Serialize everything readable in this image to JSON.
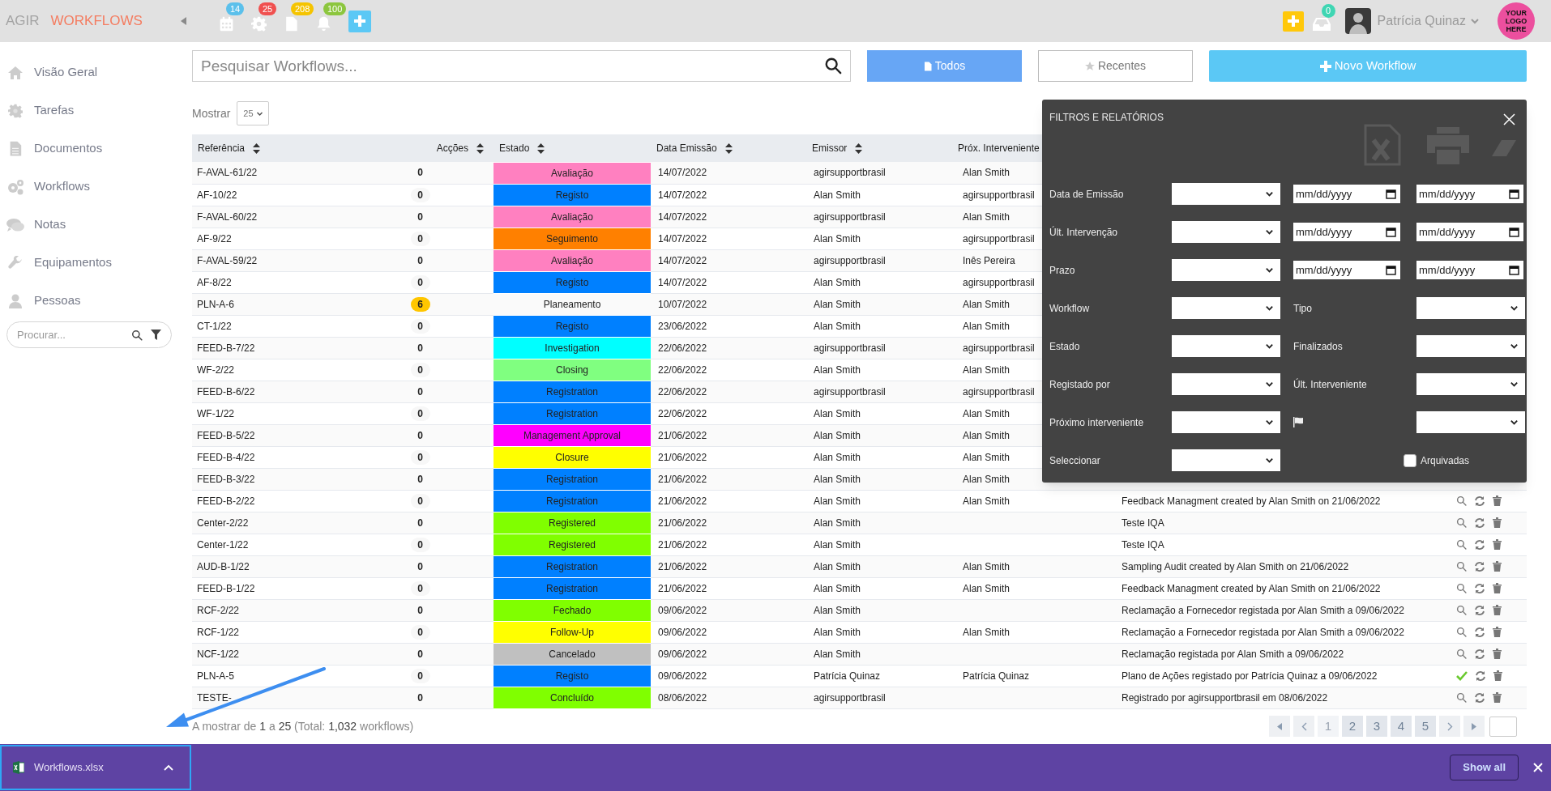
{
  "topbar": {
    "brand": "AGIR",
    "product": "WORKFLOWS",
    "notifications": [
      {
        "count": "14",
        "color": "#5bc0eb"
      },
      {
        "count": "25",
        "color": "#f0504f"
      },
      {
        "count": "208",
        "color": "#f5c400"
      },
      {
        "count": "100",
        "color": "#8cc63e"
      }
    ],
    "inbox_count": "0",
    "user": "Patrícia Quinaz",
    "logo_lines": [
      "YOUR",
      "LOGO",
      "HERE"
    ]
  },
  "sidebar": {
    "items": [
      {
        "label": "Visão Geral"
      },
      {
        "label": "Tarefas"
      },
      {
        "label": "Documentos"
      },
      {
        "label": "Workflows"
      },
      {
        "label": "Notas"
      },
      {
        "label": "Equipamentos"
      },
      {
        "label": "Pessoas"
      }
    ],
    "search": {
      "placeholder": "Procurar..."
    }
  },
  "search": {
    "placeholder": "Pesquisar Workflows..."
  },
  "view_tabs": [
    {
      "label": "Todos",
      "selected": true
    },
    {
      "label": "Recentes",
      "selected": false
    }
  ],
  "new_button": "Novo Workflow",
  "page_size": {
    "label": "Mostrar",
    "value": "25"
  },
  "table": {
    "columns": [
      "Referência",
      "Acções",
      "Estado",
      "Data Emissão",
      "Emissor",
      "Próx. Interveniente"
    ],
    "rows": [
      {
        "ref": "F-AVAL-61/22",
        "actions": "0",
        "flagged": false,
        "state": "Avaliação",
        "color": "#ff80c0",
        "date": "14/07/2022",
        "issuer": "agirsupportbrasil",
        "next": "Alan Smith"
      },
      {
        "ref": "AF-10/22",
        "actions": "0",
        "flagged": false,
        "state": "Registo",
        "color": "#0080ff",
        "date": "14/07/2022",
        "issuer": "Alan Smith",
        "next": "agirsupportbrasil"
      },
      {
        "ref": "F-AVAL-60/22",
        "actions": "0",
        "flagged": false,
        "state": "Avaliação",
        "color": "#ff80c0",
        "date": "14/07/2022",
        "issuer": "agirsupportbrasil",
        "next": "Alan Smith"
      },
      {
        "ref": "AF-9/22",
        "actions": "0",
        "flagged": false,
        "state": "Seguimento",
        "color": "#ff8000",
        "date": "14/07/2022",
        "issuer": "Alan Smith",
        "next": "agirsupportbrasil"
      },
      {
        "ref": "F-AVAL-59/22",
        "actions": "0",
        "flagged": false,
        "state": "Avaliação",
        "color": "#ff80c0",
        "date": "14/07/2022",
        "issuer": "agirsupportbrasil",
        "next": "Inês Pereira"
      },
      {
        "ref": "AF-8/22",
        "actions": "0",
        "flagged": false,
        "state": "Registo",
        "color": "#0080ff",
        "date": "14/07/2022",
        "issuer": "Alan Smith",
        "next": "agirsupportbrasil"
      },
      {
        "ref": "PLN-A-6",
        "actions": "6",
        "flagged": true,
        "state": "Planeamento",
        "date": "10/07/2022",
        "issuer": "Alan Smith",
        "next": "Alan Smith"
      },
      {
        "ref": "CT-1/22",
        "actions": "0",
        "flagged": false,
        "state": "Registo",
        "color": "#0080ff",
        "date": "23/06/2022",
        "issuer": "Alan Smith",
        "next": "Alan Smith"
      },
      {
        "ref": "FEED-B-7/22",
        "actions": "0",
        "flagged": false,
        "state": "Investigation",
        "color": "#00ffff",
        "date": "22/06/2022",
        "issuer": "agirsupportbrasil",
        "next": "agirsupportbrasil"
      },
      {
        "ref": "WF-2/22",
        "actions": "0",
        "flagged": false,
        "state": "Closing",
        "color": "#80ff80",
        "date": "22/06/2022",
        "issuer": "Alan Smith",
        "next": "Alan Smith"
      },
      {
        "ref": "FEED-B-6/22",
        "actions": "0",
        "flagged": false,
        "state": "Registration",
        "color": "#0080ff",
        "date": "22/06/2022",
        "issuer": "agirsupportbrasil",
        "next": "agirsupportbrasil"
      },
      {
        "ref": "WF-1/22",
        "actions": "0",
        "flagged": false,
        "state": "Registration",
        "color": "#0080ff",
        "date": "22/06/2022",
        "issuer": "Alan Smith",
        "next": "Alan Smith"
      },
      {
        "ref": "FEED-B-5/22",
        "actions": "0",
        "flagged": false,
        "state": "Management Approval",
        "color": "#ff00ff",
        "date": "21/06/2022",
        "issuer": "Alan Smith",
        "next": "Alan Smith"
      },
      {
        "ref": "FEED-B-4/22",
        "actions": "0",
        "flagged": false,
        "state": "Closure",
        "color": "#ffff00",
        "date": "21/06/2022",
        "issuer": "Alan Smith",
        "next": "Alan Smith"
      },
      {
        "ref": "FEED-B-3/22",
        "actions": "0",
        "flagged": false,
        "state": "Registration",
        "color": "#0080ff",
        "date": "21/06/2022",
        "issuer": "Alan Smith",
        "next": "Alan Smith"
      },
      {
        "ref": "FEED-B-2/22",
        "actions": "0",
        "flagged": false,
        "state": "Registration",
        "color": "#0080ff",
        "date": "21/06/2022",
        "issuer": "Alan Smith",
        "next": "Alan Smith",
        "title": "Feedback Managment created by Alan Smith on 21/06/2022",
        "done": false
      },
      {
        "ref": "Center-2/22",
        "actions": "0",
        "flagged": false,
        "state": "Registered",
        "color": "#80ff00",
        "date": "21/06/2022",
        "issuer": "Alan Smith",
        "title": "Teste IQA",
        "done": false
      },
      {
        "ref": "Center-1/22",
        "actions": "0",
        "flagged": false,
        "state": "Registered",
        "color": "#80ff00",
        "date": "21/06/2022",
        "issuer": "Alan Smith",
        "title": "Teste IQA",
        "done": false
      },
      {
        "ref": "AUD-B-1/22",
        "actions": "0",
        "flagged": false,
        "state": "Registration",
        "color": "#0080ff",
        "date": "21/06/2022",
        "issuer": "Alan Smith",
        "next": "Alan Smith",
        "title": "Sampling Audit created by Alan Smith on 21/06/2022",
        "done": false
      },
      {
        "ref": "FEED-B-1/22",
        "actions": "0",
        "flagged": false,
        "state": "Registration",
        "color": "#0080ff",
        "date": "21/06/2022",
        "issuer": "Alan Smith",
        "next": "Alan Smith",
        "title": "Feedback Managment created by Alan Smith on 21/06/2022",
        "done": false
      },
      {
        "ref": "RCF-2/22",
        "actions": "0",
        "flagged": false,
        "state": "Fechado",
        "color": "#80ff00",
        "date": "09/06/2022",
        "issuer": "Alan Smith",
        "title": "Reclamação a Fornecedor registada por Alan Smith a 09/06/2022",
        "done": false
      },
      {
        "ref": "RCF-1/22",
        "actions": "0",
        "flagged": false,
        "state": "Follow-Up",
        "color": "#ffff00",
        "date": "09/06/2022",
        "issuer": "Alan Smith",
        "next": "Alan Smith",
        "title": "Reclamação a Fornecedor registada por Alan Smith a 09/06/2022",
        "done": false
      },
      {
        "ref": "NCF-1/22",
        "actions": "0",
        "flagged": false,
        "state": "Cancelado",
        "color": "#c0c0c0",
        "date": "09/06/2022",
        "issuer": "Alan Smith",
        "title": "Reclamação registada por Alan Smith a 09/06/2022",
        "done": false
      },
      {
        "ref": "PLN-A-5",
        "actions": "0",
        "flagged": false,
        "state": "Registo",
        "color": "#0080ff",
        "date": "09/06/2022",
        "issuer": "Patrícia Quinaz",
        "next": "Patrícia Quinaz",
        "title": "Plano de Ações registado por Patrícia Quinaz a 09/06/2022",
        "done": true
      },
      {
        "ref": "TESTE-",
        "actions": "0",
        "flagged": false,
        "state": "Concluído",
        "color": "#80ff00",
        "date": "08/06/2022",
        "issuer": "agirsupportbrasil",
        "title": "Registrado por agirsupportbrasil em 08/06/2022",
        "done": false
      }
    ]
  },
  "summary": "A mostrar de **1** a **25** (Total: **1,032** workflows)",
  "pagination": [
    {
      "label": "1",
      "selected": true
    },
    {
      "label": "2",
      "selected": false
    },
    {
      "label": "3",
      "selected": false
    },
    {
      "label": "4",
      "selected": false
    },
    {
      "label": "5",
      "selected": false
    }
  ],
  "filter_panel": {
    "title": "FILTROS E RELATÓRIOS",
    "rows": [
      {
        "kind": "date_range",
        "label": "Data de Emissão",
        "from": {
          "placeholder": "mm/dd/yyyy"
        },
        "to": {
          "placeholder": "mm/dd/yyyy"
        }
      },
      {
        "kind": "date_range",
        "label": "Últ. Intervenção",
        "from": {
          "placeholder": "mm/dd/yyyy"
        },
        "to": {
          "placeholder": "mm/dd/yyyy"
        }
      },
      {
        "kind": "date_range",
        "label": "Prazo",
        "from": {
          "placeholder": "mm/dd/yyyy"
        },
        "to": {
          "placeholder": "mm/dd/yyyy"
        }
      },
      {
        "kind": "pair",
        "label": "Workflow",
        "label2": "Tipo"
      },
      {
        "kind": "pair",
        "label": "Estado",
        "label2": "Finalizados"
      },
      {
        "kind": "pair",
        "label": "Registado por",
        "label2": "Últ. Interveniente"
      },
      {
        "kind": "flag",
        "label": "Próximo interveniente"
      },
      {
        "kind": "checkbox",
        "label": "Seleccionar",
        "option": "Arquivadas",
        "checked": false
      }
    ]
  },
  "download_bar": {
    "file": "Workflows.xlsx",
    "show_all": "Show all"
  }
}
